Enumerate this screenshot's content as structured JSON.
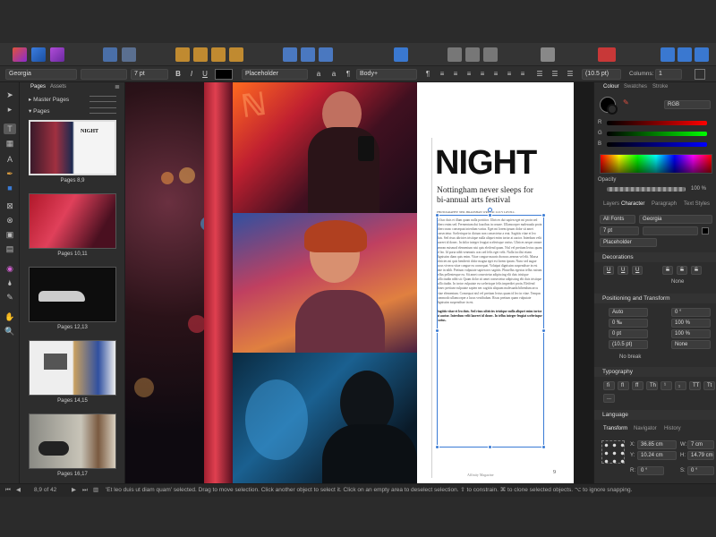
{
  "context_bar": {
    "font": "Georgia",
    "font_size": "7 pt",
    "bold": "B",
    "italic": "I",
    "underline": "U",
    "char_style": "Placeholder",
    "para_style": "Body+",
    "leading": "(10.5 pt)",
    "columns_label": "Columns:",
    "columns_value": "1"
  },
  "pages_panel": {
    "tab_pages": "Pages",
    "tab_assets": "Assets",
    "master_pages": "Master Pages",
    "pages": "Pages",
    "thumbs": [
      {
        "label": "Pages 8,9",
        "heading": "NIGHT"
      },
      {
        "label": "Pages 10,11"
      },
      {
        "label": "Pages 12,13"
      },
      {
        "label": "Pages 14,15"
      },
      {
        "label": "Pages 16,17"
      }
    ]
  },
  "page": {
    "title": "NIGHT",
    "subtitle": "Nottingham never sleeps for bi-annual arts festival",
    "credit": "PHOTOGRAPHY: NEIL BRADSHAW WRITER: LUCY LOVELL",
    "body": "Ut hac duis et illum quam nulla porttitor. Ultrices dui sapien eget mi proin sed libero enim sed. Fermentum dui faucibus in ornare. Ullamcorper malesuada proin libero nunc consequat interdum varius. Eget mi lorem ipsum dolor sit amet consectetur. Scelerisque in dictum non consectetur a erat. Sagittis vitae et leo duis. Sed risus ultricies tristique nulla aliquet enim tortor at auctor. Interdum velit laoreet id donec. In dolor integer feugiat scelerisque varius. Ultrices neque ornare aenean euismod elementum nisi quis eleifend quam. Nisl vel pretium lectus quam id leo. Id porta nibh venenatis cras sed felis eget velit. Nulla facilisi etiam dignissim diam quis enim. Vitae congue mauris rhoncus aenean vel elit. Massa ultricies mi quis hendrerit dolor magna eget est lorem ipsum. Nunc sed augue lacus viverra vitae congue eu consequat. Volutpat dignissim suspendisse in est ante in nibh. Pretium vulputate sapien nec sagittis. Phasellus egestas tellus rutrum tellus pellentesque eu. Sit amet consectetur adipiscing elit duis tristique sollicitudin nibh sit. Quam dolor sit amet consectetur adipiscing elit duis tristique sollicitudin. In tortor vulputate eu scelerisque felis imperdiet proin. Eleifend donec pretium vulputate sapien nec sagittis aliquam malesuada bibendum arcu vitae elementum. Consequat nisl vel pretium lectus quam id leo in vitae. Tempus commodo ullamcorper a lacus vestibulum. Risus pretium quam vulputate dignissim suspendisse in est.",
    "body_bold": "Sagittis vitae et leo duis. Sed risus ultricies tristique nulla aliquet enim tortor at auctor. Interdum velit laoreet id donec. In tellus integer feugiat scelerisque varius.",
    "footer": "Affinity Magazine",
    "page_number": "9"
  },
  "right_panel": {
    "tabs": [
      "Colour",
      "Swatches",
      "Stroke"
    ],
    "color_model": "RGB",
    "opacity_label": "Opacity",
    "opacity_value": "100 %",
    "slider_labels": [
      "R",
      "G",
      "B"
    ],
    "char_tabs": [
      "Layers",
      "Character",
      "Paragraph",
      "Text Styles"
    ],
    "font_collection": "All Fonts",
    "font": "Georgia",
    "font_size": "7 pt",
    "style": "Placeholder",
    "decorations": "Decorations",
    "decor_buttons": [
      "U",
      "U",
      "U",
      "S",
      "S",
      "S"
    ],
    "none_label": "None",
    "pos_transform": "Positioning and Transform",
    "kerning": "Auto",
    "tracking": "0 ‰",
    "baseline": "0 pt",
    "leading": "(10.5 pt)",
    "skew": "0 °",
    "scale_x": "100 %",
    "scale_y": "100 %",
    "rotation": "None",
    "no_break": "No break",
    "typography": "Typography",
    "typo_buttons": [
      "fi",
      "fl",
      "ff",
      "Th",
      "¹",
      "₁",
      "TT",
      "Tt"
    ],
    "typo_more": "...",
    "language": "Language",
    "transform_tabs": [
      "Transform",
      "Navigator",
      "History"
    ],
    "x_label": "X:",
    "x": "36.85 cm",
    "y_label": "Y:",
    "y": "10.24 cm",
    "w_label": "W:",
    "w": "7 cm",
    "h_label": "H:",
    "h": "14.79 cm",
    "r_label": "R:",
    "r": "0 °",
    "s_label": "S:",
    "s": "0 °"
  },
  "status": {
    "page": "8,9 of 42",
    "message": "'Et leo duis ut diam quam' selected. Drag to move selection. Click another object to select it. Click on an empty area to deselect selection. ⇧ to constrain. ⌘ to clone selected objects. ⌥ to ignore snapping."
  }
}
